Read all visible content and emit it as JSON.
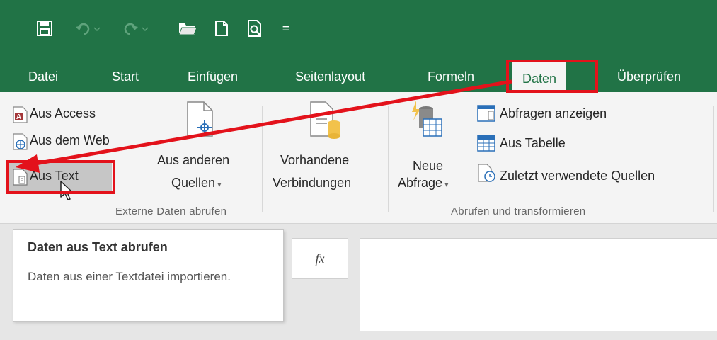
{
  "colors": {
    "brand": "#217346",
    "highlight": "#e3121b"
  },
  "qat": {
    "icons": [
      "save-icon",
      "undo-icon",
      "redo-icon",
      "open-folder-icon",
      "new-document-icon",
      "print-preview-icon",
      "customize-quick-access-icon"
    ],
    "customize_glyph": "="
  },
  "tabs": [
    "Datei",
    "Start",
    "Einfügen",
    "Seitenlayout",
    "Formeln",
    "Daten",
    "Überprüfen"
  ],
  "active_tab": "Daten",
  "ribbon": {
    "external": {
      "aus_access": "Aus Access",
      "aus_dem_web": "Aus dem Web",
      "aus_text": "Aus Text",
      "aus_anderen_line1": "Aus anderen",
      "aus_anderen_line2": "Quellen",
      "vorhandene_line1": "Vorhandene",
      "vorhandene_line2": "Verbindungen",
      "group_label": "Externe Daten abrufen"
    },
    "transform": {
      "neue_line1": "Neue",
      "neue_line2": "Abfrage",
      "abfragen_anzeigen": "Abfragen anzeigen",
      "aus_tabelle": "Aus Tabelle",
      "zuletzt": "Zuletzt verwendete Quellen",
      "group_label": "Abrufen und transformieren"
    }
  },
  "tooltip": {
    "title": "Daten aus Text abrufen",
    "body": "Daten aus einer Textdatei importieren."
  },
  "formula_bar": {
    "fx_label": "fx"
  }
}
